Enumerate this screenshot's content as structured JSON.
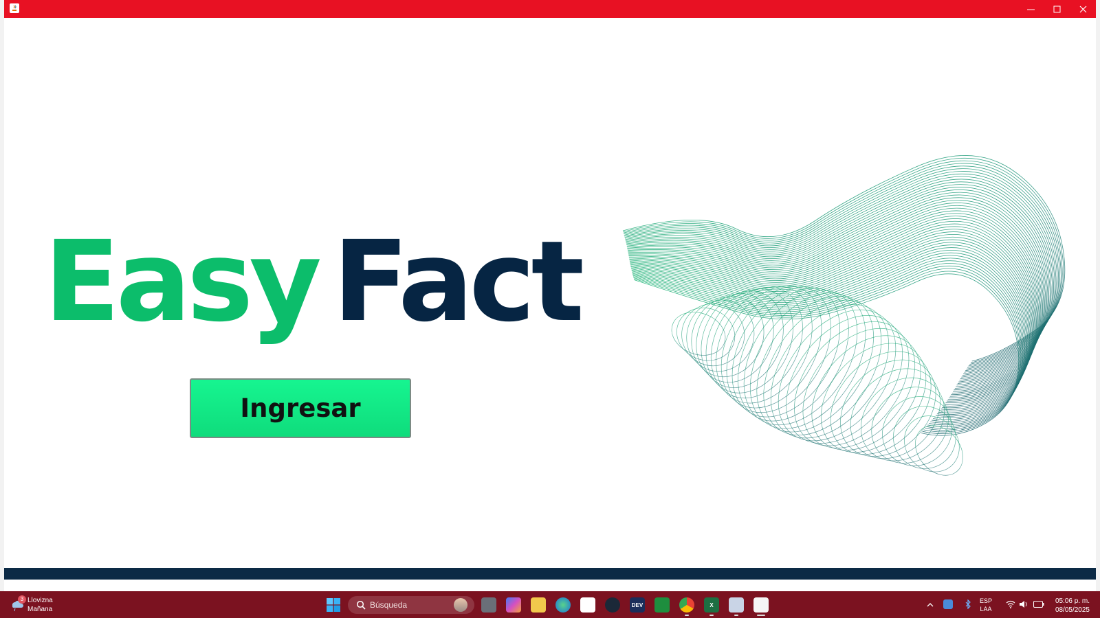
{
  "window": {
    "title_bar_color": "#e81123",
    "buttons": {
      "minimize": "minimize-icon",
      "maximize": "maximize-icon",
      "close": "close-icon"
    }
  },
  "logo": {
    "part1": "Easy",
    "part2": "Fact",
    "part1_color": "#0cbd6b",
    "part2_color": "#062543"
  },
  "main": {
    "enter_button_label": "Ingresar",
    "enter_button_color": "#14ea88"
  },
  "taskbar": {
    "weather": {
      "badge": "3",
      "condition": "Llovizna",
      "when": "Mañana"
    },
    "search": {
      "placeholder": "Búsqueda"
    },
    "apps": [
      "task-view",
      "copilot",
      "file-explorer",
      "edge",
      "microsoft-store",
      "steam",
      "dev-home",
      "google-classroom",
      "chrome",
      "excel",
      "virtualbox",
      "java-app"
    ],
    "tray": {
      "language_line1": "ESP",
      "language_line2": "LAA",
      "time": "05:06 p. m.",
      "date": "08/05/2025"
    }
  }
}
